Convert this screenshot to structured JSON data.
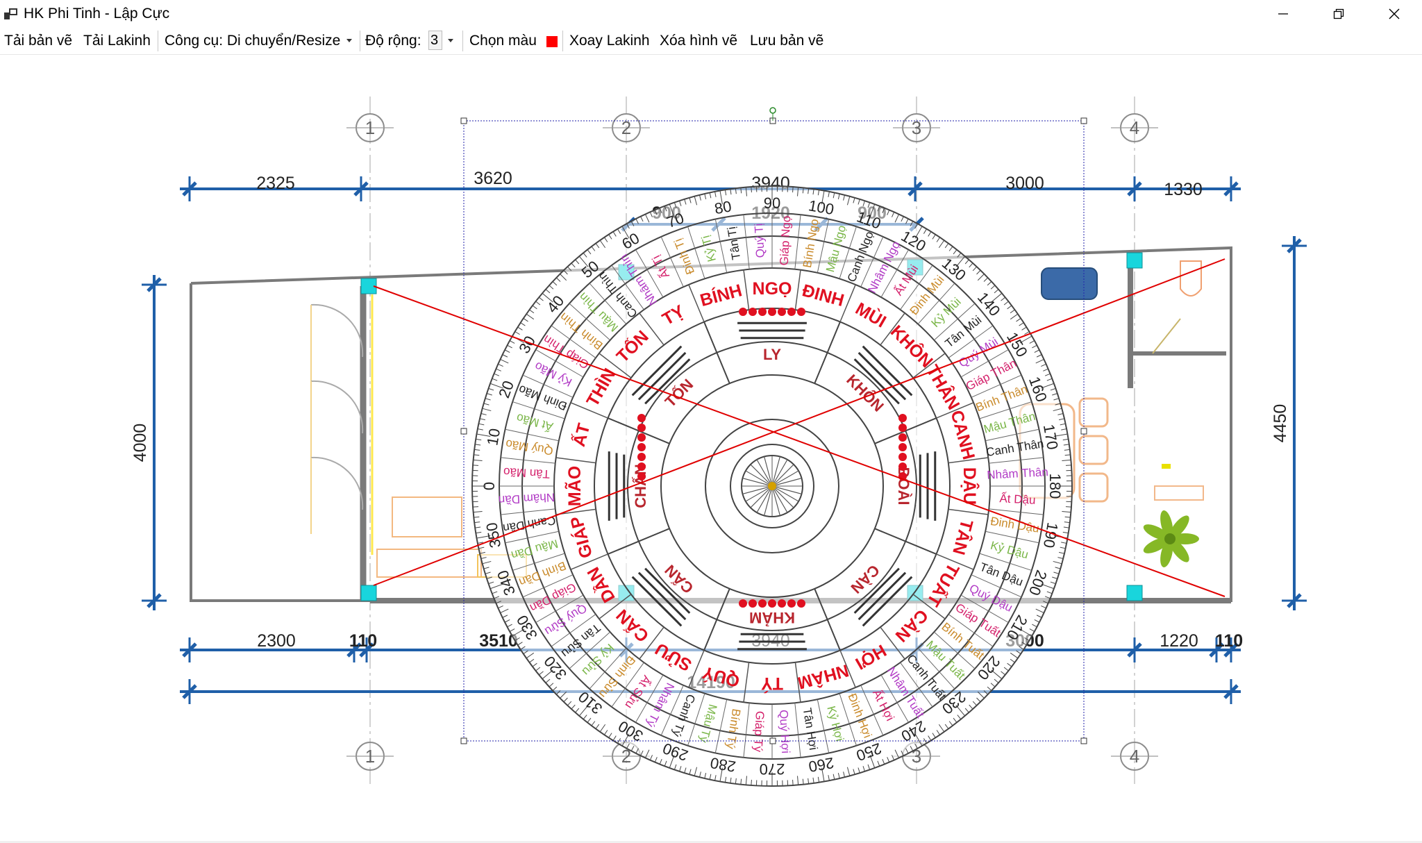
{
  "window": {
    "title": "HK Phi Tinh - Lập Cực",
    "icon": "app-window-icon",
    "controls": [
      "minimize-icon",
      "maximize-icon",
      "close-icon"
    ]
  },
  "menu": {
    "load_drawing": "Tải bản vẽ",
    "load_lakinh": "Tải Lakinh",
    "tool": "Công cụ: Di chuyển/Resize",
    "width_label": "Độ rộng:",
    "width_value": "3",
    "choose_color": "Chọn màu",
    "selected_color": "#ff0000",
    "rotate_lakinh": "Xoay Lakinh",
    "delete_drawing": "Xóa hình vẽ",
    "save_drawing": "Lưu bản vẽ"
  },
  "plan": {
    "grid_labels": [
      "1",
      "2",
      "3",
      "4"
    ],
    "dims_top": [
      "2325",
      "3620",
      "3940",
      "3000",
      "1330"
    ],
    "dims_inner_top": [
      "900",
      "1920",
      "900"
    ],
    "dims_bottom": [
      "2300",
      "110",
      "3510",
      "3940",
      "3000",
      "1220",
      "110"
    ],
    "dim_total": "14190",
    "dim_left": "4000",
    "dim_right": "4450",
    "line_color": "#1f5fa8",
    "wall_color": "#7a7a7a",
    "diagonal_color": "#e00000",
    "column_color": "#19d5dc"
  },
  "compass": {
    "degrees": [
      "0",
      "10",
      "20",
      "30",
      "40",
      "50",
      "60",
      "70",
      "80",
      "90",
      "100",
      "110",
      "120",
      "130",
      "140",
      "150",
      "160",
      "170",
      "180",
      "190",
      "200",
      "210",
      "220",
      "230",
      "240",
      "250",
      "260",
      "270",
      "280",
      "290",
      "300",
      "310",
      "320",
      "330",
      "340",
      "350"
    ],
    "trigrams": [
      "CHẤN",
      "TỐN",
      "LY",
      "KHÔN",
      "ĐOÀI",
      "CÀN",
      "KHẢM",
      "CẤN"
    ],
    "mountains": [
      "MÃO",
      "ẤT",
      "THÌN",
      "TỐN",
      "TỴ",
      "BÍNH",
      "NGỌ",
      "ĐINH",
      "MÙI",
      "KHÔN",
      "THÂN",
      "CANH",
      "DẬU",
      "TÂN",
      "TUẤT",
      "CÀN",
      "HỢI",
      "NHÂM",
      "TÝ",
      "QUÝ",
      "SỬU",
      "CẤN",
      "DẦN",
      "GIÁP"
    ],
    "sub_ring": [
      "Tân Mão",
      "Quý Mão",
      "Ất Mão",
      "Đinh Mão",
      "Kỷ Mão",
      "Giáp Thìn",
      "Bính Thìn",
      "Mậu Thìn",
      "Canh Thìn",
      "Nhâm Thìn",
      "Ất Tị",
      "Đinh Tị",
      "Kỷ Tị",
      "Tân Tị",
      "Quý Tị",
      "Giáp Ngọ",
      "Bính Ngọ",
      "Mậu Ngọ",
      "Canh Ngọ",
      "Nhâm Ngọ",
      "Ất Mùi",
      "Đinh Mùi",
      "Kỷ Mùi",
      "Tân Mùi",
      "Quý Mùi",
      "Giáp Thân",
      "Bính Thân",
      "Mậu Thân",
      "Canh Thân",
      "Nhâm Thân",
      "Ất Dậu",
      "Đinh Dậu",
      "Kỷ Dậu",
      "Tân Dậu",
      "Quý Dậu",
      "Giáp Tuất",
      "Bính Tuất",
      "Mậu Tuất",
      "Canh Tuất",
      "Nhâm Tuất",
      "Ất Hợi",
      "Đinh Hợi",
      "Kỷ Hợi",
      "Tân Hợi",
      "Quý Hợi",
      "Giáp Tý",
      "Bính Tý",
      "Mậu Tý",
      "Canh Tý",
      "Nhâm Tý",
      "Ất Sửu",
      "Đinh Sửu",
      "Kỷ Sửu",
      "Tân Sửu",
      "Quý Sửu",
      "Giáp Dần",
      "Bính Dần",
      "Mậu Dần",
      "Canh Dần",
      "Nhâm Dần"
    ]
  }
}
